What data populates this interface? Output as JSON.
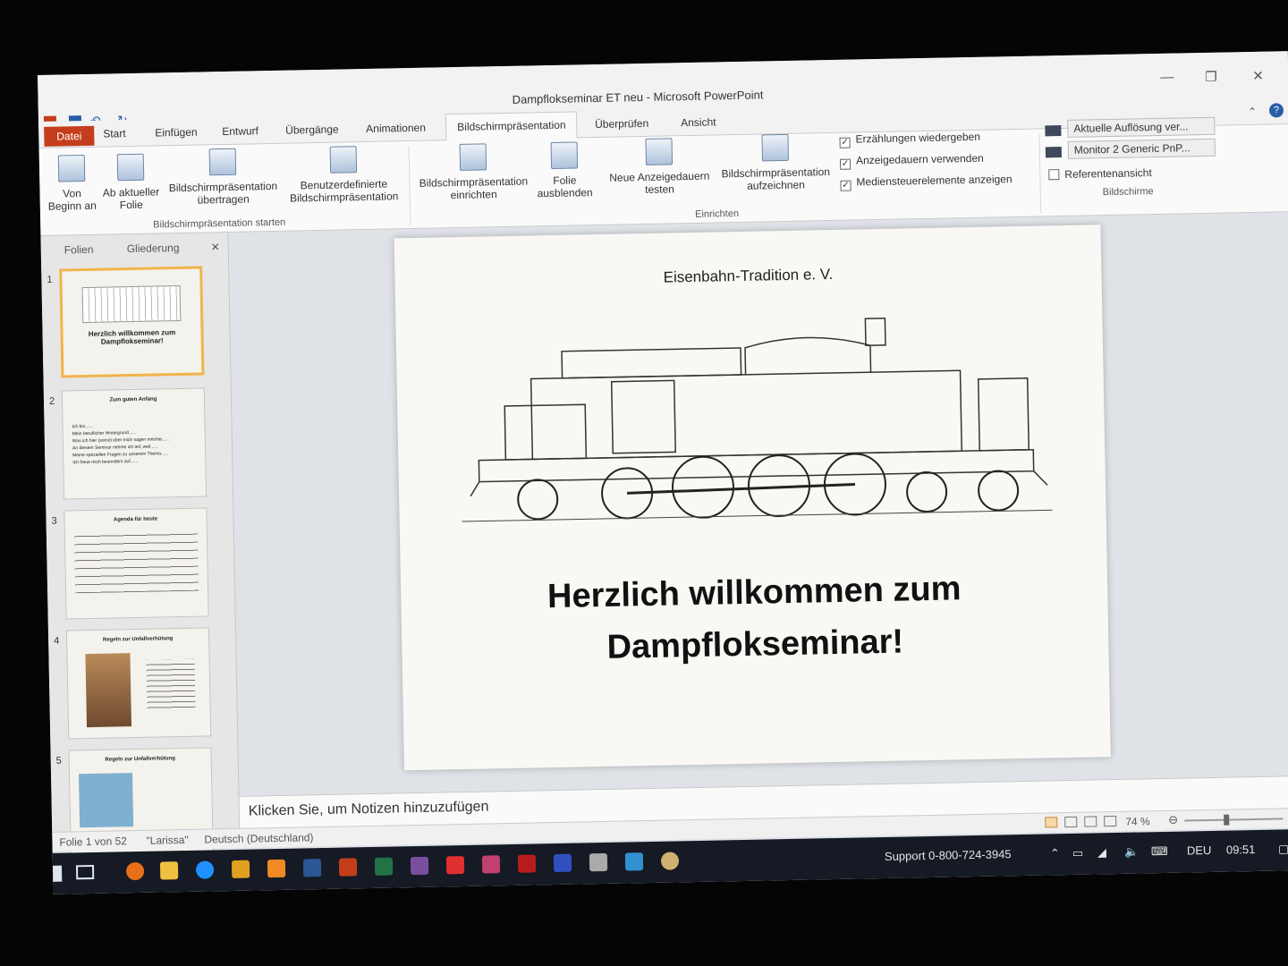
{
  "window": {
    "title": "Dampflokseminar ET neu  -  Microsoft PowerPoint",
    "minimize_icon": "minimize-icon",
    "restore_icon": "restore-icon",
    "close_icon": "close-icon"
  },
  "tabs": [
    {
      "label": "Datei"
    },
    {
      "label": "Start"
    },
    {
      "label": "Einfügen"
    },
    {
      "label": "Entwurf"
    },
    {
      "label": "Übergänge"
    },
    {
      "label": "Animationen"
    },
    {
      "label": "Bildschirmpräsentation"
    },
    {
      "label": "Überprüfen"
    },
    {
      "label": "Ansicht"
    }
  ],
  "ribbon": {
    "start_group": {
      "label": "Bildschirmpräsentation starten",
      "buttons": [
        {
          "label": "Von Beginn an"
        },
        {
          "label": "Ab aktueller Folie"
        },
        {
          "label": "Bildschirmpräsentation übertragen"
        },
        {
          "label": "Benutzerdefinierte Bildschirmpräsentation"
        }
      ]
    },
    "setup_group": {
      "label": "Einrichten",
      "buttons": [
        {
          "label": "Bildschirmpräsentation einrichten"
        },
        {
          "label": "Folie ausblenden"
        },
        {
          "label": "Neue Anzeigedauern testen"
        },
        {
          "label": "Bildschirmpräsentation aufzeichnen"
        }
      ],
      "checks": [
        {
          "label": "Erzählungen wiedergeben",
          "checked": true
        },
        {
          "label": "Anzeigedauern verwenden",
          "checked": true
        },
        {
          "label": "Mediensteuerelemente anzeigen",
          "checked": true
        }
      ]
    },
    "monitors_group": {
      "label": "Bildschirme",
      "resolution": "Aktuelle Auflösung ver...",
      "monitor": "Monitor 2 Generic PnP...",
      "presenter_view": "Referentenansicht",
      "presenter_checked": false
    }
  },
  "left_pane": {
    "tab_slides": "Folien",
    "tab_outline": "Gliederung",
    "close": "✕",
    "thumbs": [
      {
        "num": "1",
        "title": "Herzlich willkommen zum Dampflokseminar!"
      },
      {
        "num": "2",
        "title": "Zum guten Anfang",
        "lines": [
          "Ich bin......",
          "Mein beruflicher Hintergrund......",
          "Was ich hier (sonst) über mich sagen möchte......",
          "An diesem Seminar nehme ich teil, weil......",
          "Meine speziellen Fragen zu unserem Thema......",
          "Ich freue mich besonders auf......"
        ]
      },
      {
        "num": "3",
        "title": "Agenda für heute"
      },
      {
        "num": "4",
        "title": "Regeln zur Unfallverhütung"
      },
      {
        "num": "5",
        "title": "Regeln zur Unfallverhütung"
      }
    ]
  },
  "slide": {
    "club": "Eisenbahn-Tradition e. V.",
    "heading_line1": "Herzlich willkommen zum",
    "heading_line2": "Dampflokseminar!"
  },
  "notes_placeholder": "Klicken Sie, um Notizen hinzuzufügen",
  "status": {
    "slide_info": "Folie 1 von 52",
    "theme": "\"Larissa\"",
    "language": "Deutsch (Deutschland)",
    "zoom": "74 %"
  },
  "taskbar": {
    "support": "Support 0-800-724-3945",
    "lang": "DEU",
    "time": "09:51"
  }
}
